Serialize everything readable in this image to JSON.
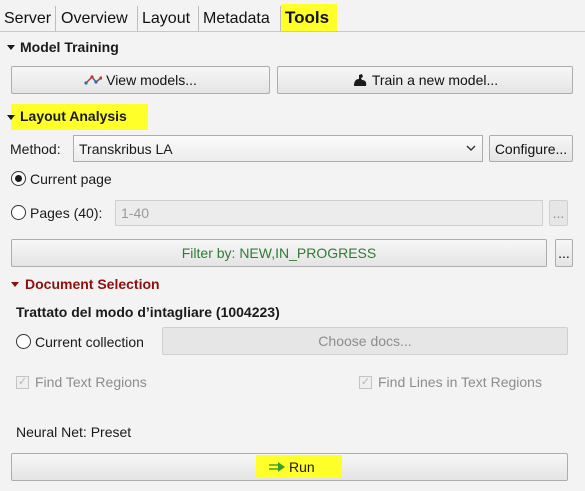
{
  "tabs": [
    "Server",
    "Overview",
    "Layout",
    "Metadata",
    "Tools"
  ],
  "active_tab": "Tools",
  "model_training": {
    "title": "Model Training",
    "view_models_label": "View models...",
    "train_label": "Train a new model..."
  },
  "layout_analysis": {
    "title": "Layout Analysis",
    "method_label": "Method:",
    "method_value": "Transkribus LA",
    "configure_label": "Configure...",
    "current_page_label": "Current page",
    "pages_label": "Pages (40):",
    "pages_value": "1-40",
    "pages_more_label": "...",
    "filter_label": "Filter by: NEW,IN_PROGRESS",
    "filter_more_label": "...",
    "current_page_selected": true
  },
  "document_selection": {
    "title": "Document Selection",
    "document_name": "Trattato del modo d’intagliare (1004223)",
    "current_collection_label": "Current collection",
    "choose_docs_label": "Choose docs..."
  },
  "options": {
    "find_text_regions_label": "Find Text Regions",
    "find_lines_label": "Find Lines in Text Regions"
  },
  "neural_net_label": "Neural Net: Preset",
  "run_label": "Run",
  "colors": {
    "highlight": "#ffff2a",
    "filter_text": "#2e7d32",
    "section_red": "#8b1010",
    "run_arrow": "#3a9e2f"
  }
}
